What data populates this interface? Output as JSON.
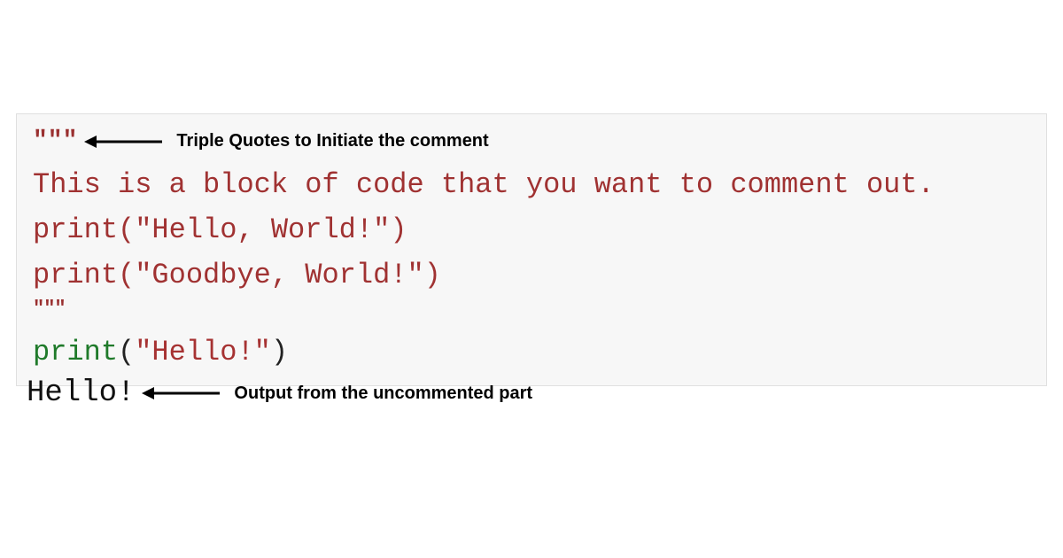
{
  "code": {
    "open_quotes": "\"\"\"",
    "close_quotes": "\"\"\"",
    "comment_line1": "This is a block of code that you want to comment out.",
    "comment_line2_ident": "print",
    "comment_line2_paren_open": "(",
    "comment_line2_string": "\"Hello, World!\"",
    "comment_line2_paren_close": ")",
    "comment_line3_ident": "print",
    "comment_line3_paren_open": "(",
    "comment_line3_string": "\"Goodbye, World!\"",
    "comment_line3_paren_close": ")",
    "active_ident": "print",
    "active_paren_open": "(",
    "active_string": "\"Hello!\"",
    "active_paren_close": ")"
  },
  "annotations": {
    "triple_quote_label": "Triple Quotes to Initiate the comment",
    "output_label": "Output from the uncommented part"
  },
  "output": {
    "text": "Hello!"
  }
}
